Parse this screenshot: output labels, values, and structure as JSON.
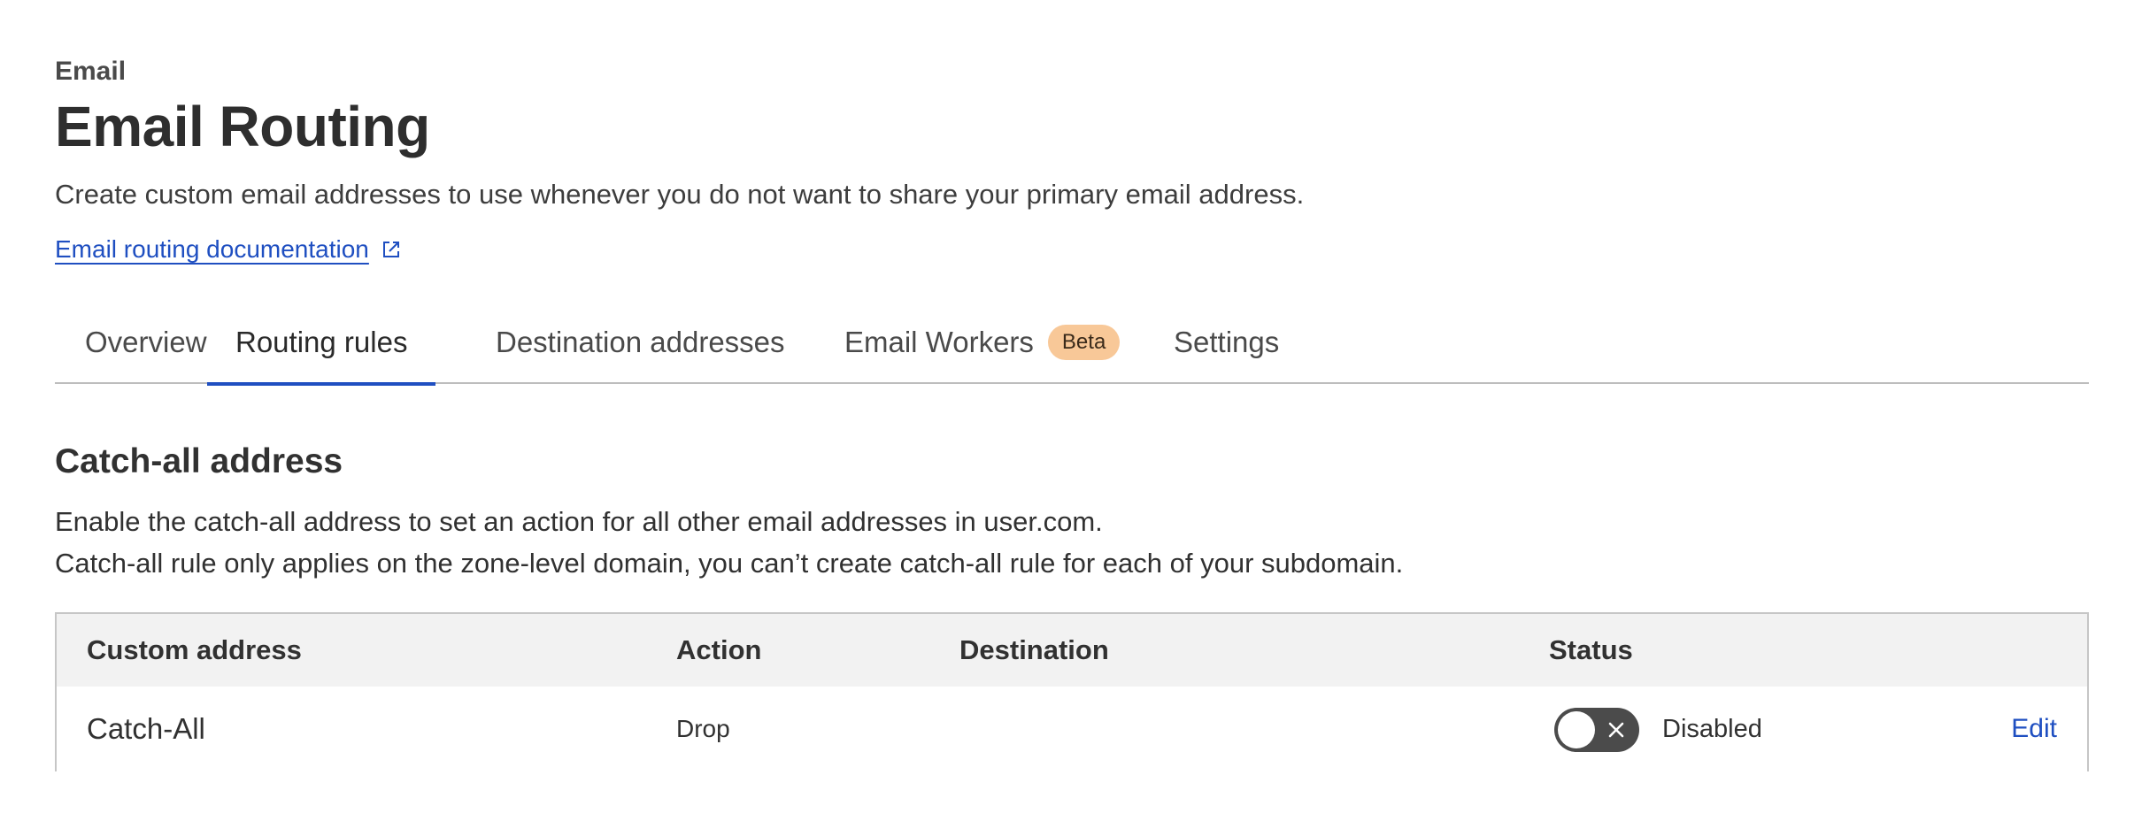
{
  "header": {
    "eyebrow": "Email",
    "title": "Email Routing",
    "description": "Create custom email addresses to use whenever you do not want to share your primary email address.",
    "doc_link": "Email routing documentation"
  },
  "tabs": [
    {
      "label": "Overview",
      "active": false
    },
    {
      "label": "Routing rules",
      "active": true
    },
    {
      "label": "Destination addresses",
      "active": false
    },
    {
      "label": "Email Workers",
      "badge": "Beta",
      "active": false
    },
    {
      "label": "Settings",
      "active": false
    }
  ],
  "catch_all": {
    "title": "Catch-all address",
    "description_line1": "Enable the catch-all address to set an action for all other email addresses in user.com.",
    "description_line2": "Catch-all rule only applies on the zone-level domain, you can’t create catch-all rule for each of your subdomain.",
    "table": {
      "columns": [
        "Custom address",
        "Action",
        "Destination",
        "Status"
      ],
      "rows": [
        {
          "custom_address": "Catch-All",
          "action": "Drop",
          "destination": "",
          "status": "Disabled",
          "enabled": false,
          "edit_label": "Edit"
        }
      ]
    }
  },
  "colors": {
    "link": "#1f4fc1",
    "badge_bg": "#f8c898",
    "toggle_off": "#4b4b4b",
    "table_header_bg": "#f2f2f2"
  }
}
